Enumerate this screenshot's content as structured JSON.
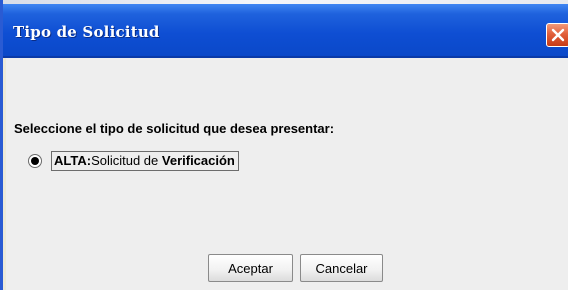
{
  "window": {
    "title": "Tipo de Solicitud"
  },
  "dialog": {
    "prompt": "Seleccione el tipo de solicitud que desea presentar:",
    "option": {
      "prefix": "ALTA:",
      "middle": "Solicitud de ",
      "suffix": "Verificación",
      "selected": true
    },
    "buttons": {
      "accept_label": "Aceptar",
      "cancel_label": "Cancelar"
    }
  },
  "colors": {
    "titlebar": "#0e4ed3",
    "close_button": "#e2603b",
    "dialog_background": "#eeeeee"
  },
  "icons": {
    "close": "close-icon"
  }
}
